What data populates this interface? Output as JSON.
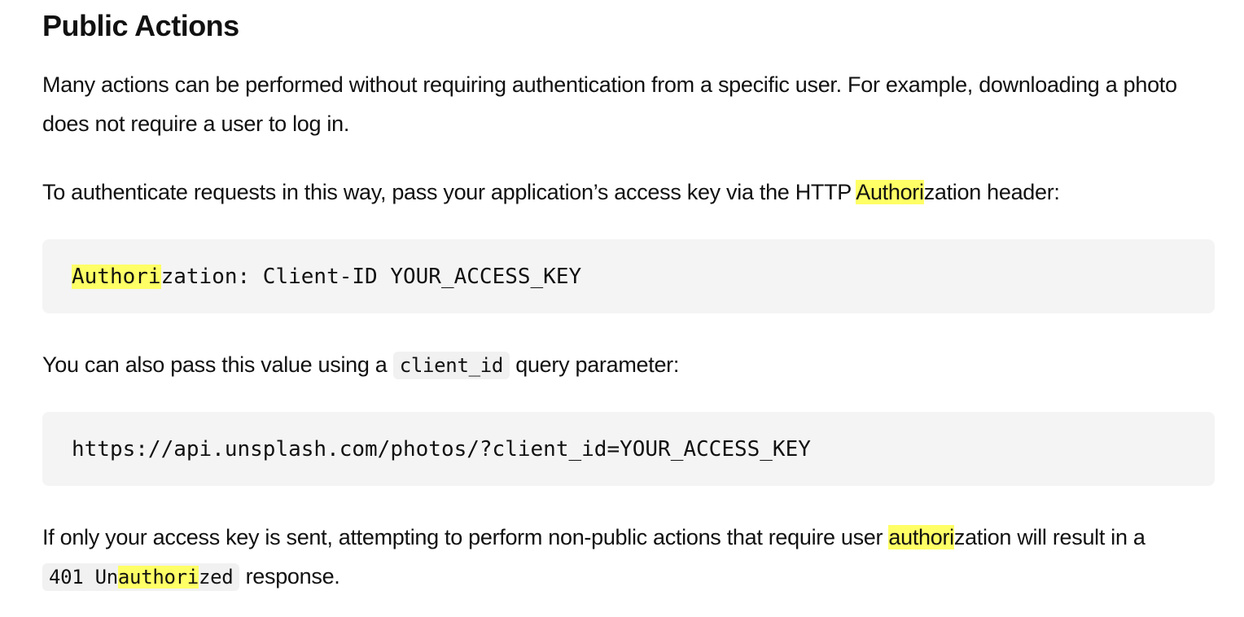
{
  "heading": "Public Actions",
  "para1": "Many actions can be performed without requiring authentication from a specific user. For example, downloading a photo does not require a user to log in.",
  "para2": {
    "before": "To authenticate requests in this way, pass your application’s access key via the HTTP ",
    "highlight": "Authori",
    "after": "zation header:"
  },
  "code1": {
    "highlight": "Authori",
    "rest": "zation: Client-ID YOUR_ACCESS_KEY"
  },
  "para3": {
    "before": "You can also pass this value using a ",
    "code": "client_id",
    "after": " query parameter:"
  },
  "code2": "https://api.unsplash.com/photos/?client_id=YOUR_ACCESS_KEY",
  "para4": {
    "before": "If only your access key is sent, attempting to perform non-public actions that require user ",
    "highlight": "authori",
    "after": "zation will result in a ",
    "code_before": "401 Un",
    "code_highlight": "authori",
    "code_after": "zed",
    "end": " response."
  },
  "colors": {
    "highlight": "#ffff66",
    "code_background": "#f4f4f4",
    "text": "#111111"
  }
}
